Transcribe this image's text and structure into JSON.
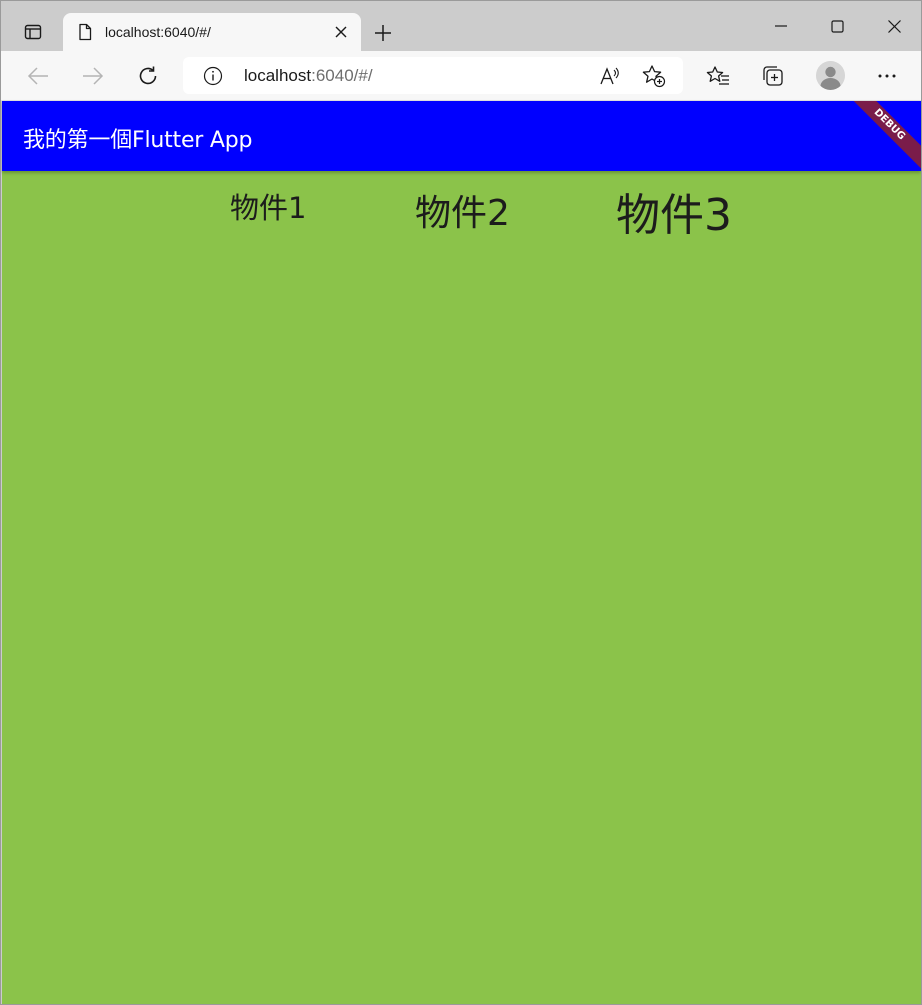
{
  "browser": {
    "tab": {
      "title": "localhost:6040/#/"
    },
    "address": {
      "host": "localhost",
      "rest": ":6040/#/"
    },
    "icons": {
      "tab_actions": "tab-actions-icon",
      "page": "page-icon",
      "close": "close-icon",
      "new_tab": "plus-icon",
      "minimize": "minimize-icon",
      "maximize": "maximize-icon",
      "close_window": "close-window-icon",
      "back": "back-arrow-icon",
      "forward": "forward-arrow-icon",
      "refresh": "refresh-icon",
      "info": "info-icon",
      "read_aloud": "read-aloud-icon",
      "add_favorite": "add-favorite-icon",
      "favorites": "favorites-icon",
      "collections": "collections-icon",
      "profile": "profile-icon",
      "more": "more-icon"
    }
  },
  "app": {
    "title": "我的第一個Flutter App",
    "debug_banner": "DEBUG",
    "appbar_color": "#0000ff",
    "background_color": "#8bc34a",
    "items": [
      {
        "label": "物件1"
      },
      {
        "label": "物件2"
      },
      {
        "label": "物件3"
      }
    ]
  }
}
